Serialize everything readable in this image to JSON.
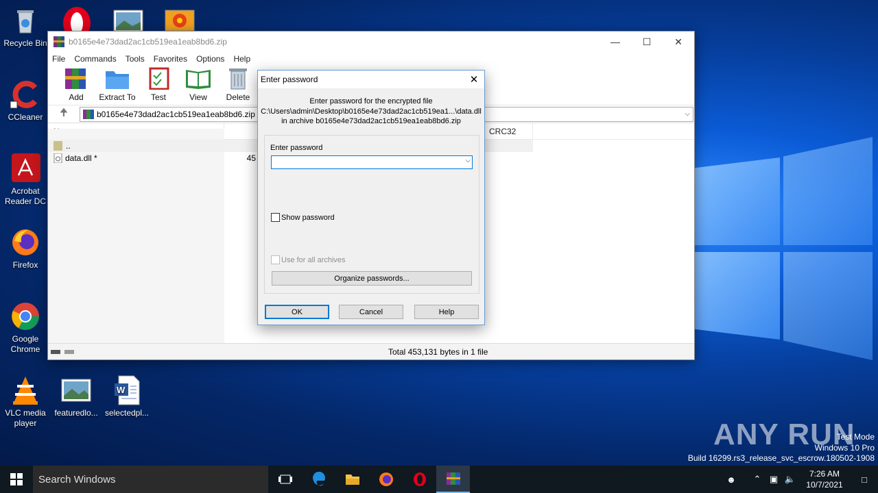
{
  "desktop": {
    "icons": [
      {
        "label": "Recycle Bin",
        "icon": "recycle-bin-icon"
      },
      {
        "label": "CCleaner",
        "icon": "ccleaner-icon"
      },
      {
        "label": "Acrobat Reader DC",
        "icon": "acrobat-icon"
      },
      {
        "label": "Firefox",
        "icon": "firefox-icon"
      },
      {
        "label": "Google Chrome",
        "icon": "chrome-icon"
      },
      {
        "label": "VLC media player",
        "icon": "vlc-icon"
      },
      {
        "label": "featuredlo...",
        "icon": "image-file-icon"
      },
      {
        "label": "selectedpl...",
        "icon": "word-doc-icon"
      }
    ]
  },
  "winrar": {
    "title": "b0165e4e73dad2ac1cb519ea1eab8bd6.zip",
    "menu": [
      "File",
      "Commands",
      "Tools",
      "Favorites",
      "Options",
      "Help"
    ],
    "toolbar": [
      "Add",
      "Extract To",
      "Test",
      "View",
      "Delete"
    ],
    "address": "b0165e4e73dad2ac1cb519ea1eab8bd6.zip - ",
    "columns": {
      "name": "Name",
      "crc": "CRC32"
    },
    "rows": [
      {
        "name": "..",
        "size": ""
      },
      {
        "name": "data.dll *",
        "size": "45"
      }
    ],
    "status": "Total 453,131 bytes in 1 file"
  },
  "dialog": {
    "title": "Enter password",
    "info_line1": "Enter password for the encrypted file",
    "info_line2": "C:\\Users\\admin\\Desktop\\b0165e4e73dad2ac1cb519ea1...\\data.dll",
    "info_line3": "in archive b0165e4e73dad2ac1cb519ea1eab8bd6.zip",
    "field_label": "Enter password",
    "field_value": "",
    "show_password": "Show password",
    "use_for_all": "Use for all archives",
    "organize": "Organize passwords...",
    "ok": "OK",
    "cancel": "Cancel",
    "help": "Help"
  },
  "taskbar": {
    "search_placeholder": "Search Windows",
    "time": "7:26 AM",
    "date": "10/7/2021"
  },
  "watermark": {
    "brand": "ANY RUN",
    "line1": "Test Mode",
    "line2": "Windows 10 Pro",
    "line3": "Build 16299.rs3_release_svc_escrow.180502-1908"
  }
}
